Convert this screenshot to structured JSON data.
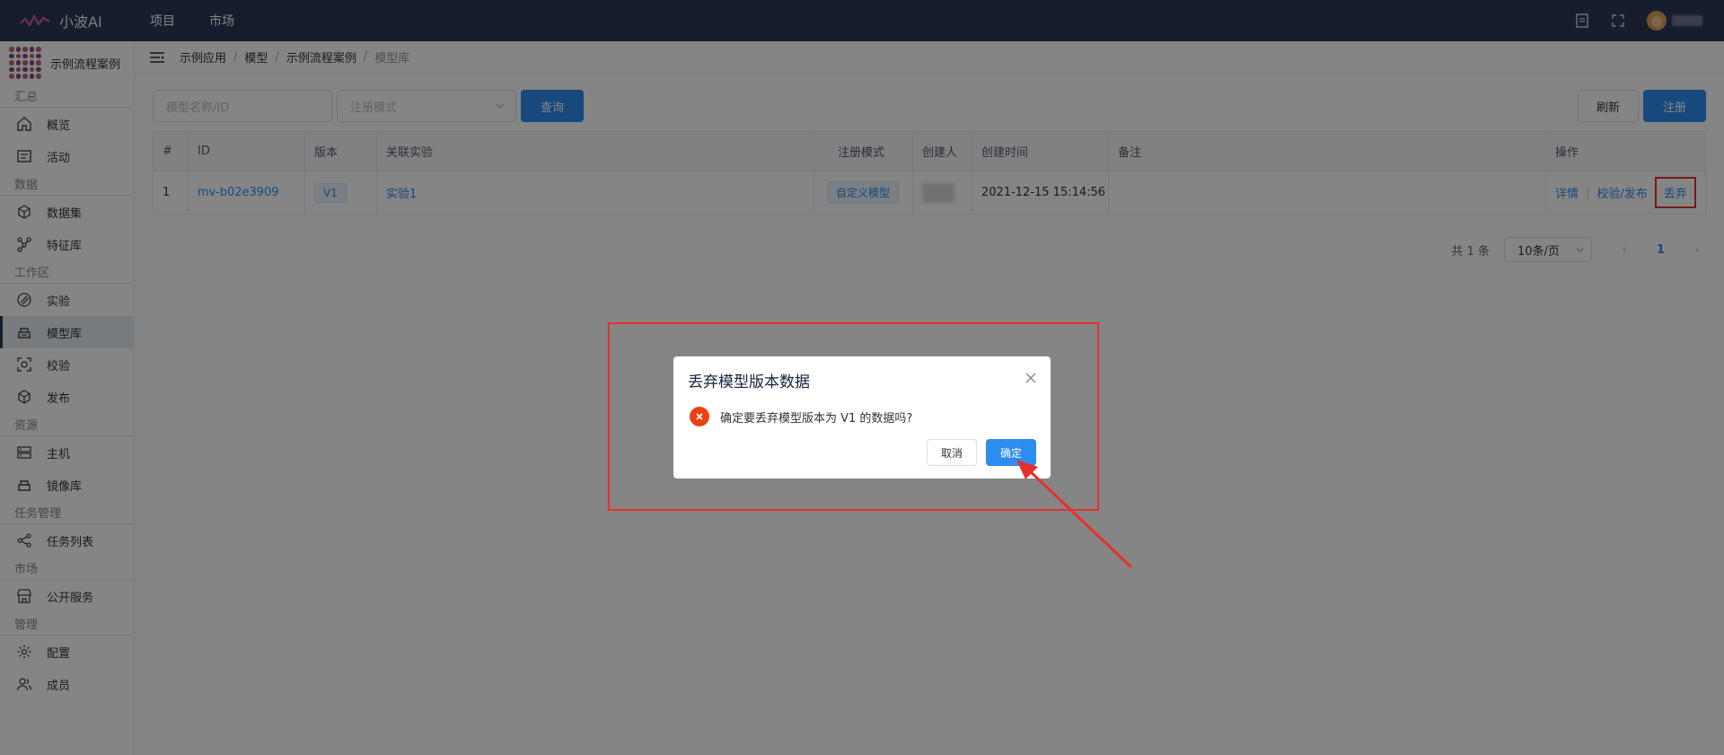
{
  "app": {
    "brand": "小波AI"
  },
  "top_nav": [
    "项目",
    "市场"
  ],
  "project": {
    "name": "示例流程案例"
  },
  "sidebar": {
    "sections": [
      {
        "title": "汇总",
        "items": [
          {
            "label": "概览",
            "icon": "home-icon"
          },
          {
            "label": "活动",
            "icon": "activity-icon"
          }
        ]
      },
      {
        "title": "数据",
        "items": [
          {
            "label": "数据集",
            "icon": "cube-icon"
          },
          {
            "label": "特征库",
            "icon": "molecule-icon"
          }
        ]
      },
      {
        "title": "工作区",
        "items": [
          {
            "label": "实验",
            "icon": "experiment-icon"
          },
          {
            "label": "模型库",
            "icon": "model-icon",
            "active": true
          },
          {
            "label": "校验",
            "icon": "scan-icon"
          },
          {
            "label": "发布",
            "icon": "package-icon"
          }
        ]
      },
      {
        "title": "资源",
        "items": [
          {
            "label": "主机",
            "icon": "server-icon"
          },
          {
            "label": "镜像库",
            "icon": "image-repo-icon"
          }
        ]
      },
      {
        "title": "任务管理",
        "items": [
          {
            "label": "任务列表",
            "icon": "task-icon"
          }
        ]
      },
      {
        "title": "市场",
        "items": [
          {
            "label": "公开服务",
            "icon": "store-icon"
          }
        ]
      },
      {
        "title": "管理",
        "items": [
          {
            "label": "配置",
            "icon": "gear-icon"
          },
          {
            "label": "成员",
            "icon": "users-icon"
          }
        ]
      }
    ]
  },
  "breadcrumb": [
    "示例应用",
    "模型",
    "示例流程案例",
    "模型库"
  ],
  "filters": {
    "name_placeholder": "模型名称/ID",
    "mode_placeholder": "注册模式",
    "query_label": "查询"
  },
  "actions": {
    "refresh": "刷新",
    "register": "注册"
  },
  "table": {
    "headers": [
      "#",
      "ID",
      "版本",
      "关联实验",
      "注册模式",
      "创建人",
      "创建时间",
      "备注",
      "操作"
    ],
    "rows": [
      {
        "index": "1",
        "id": "mv-b02e3909",
        "version": "V1",
        "experiment": "实验1",
        "mode": "自定义模型",
        "creator": "",
        "created": "2021-12-15 15:14:56",
        "note": "",
        "ops": [
          "详情",
          "校验/发布",
          "丢弃"
        ]
      }
    ]
  },
  "pager": {
    "total": "共 1 条",
    "page_size": "10条/页",
    "current": "1"
  },
  "modal": {
    "title": "丢弃模型版本数据",
    "message": "确定要丢弃模型版本为 V1 的数据吗?",
    "cancel": "取消",
    "ok": "确定"
  },
  "colors": {
    "topbar": "#2b3a56",
    "primary": "#2d8cf0",
    "highlight": "#e6302c",
    "error": "#ed4014"
  }
}
